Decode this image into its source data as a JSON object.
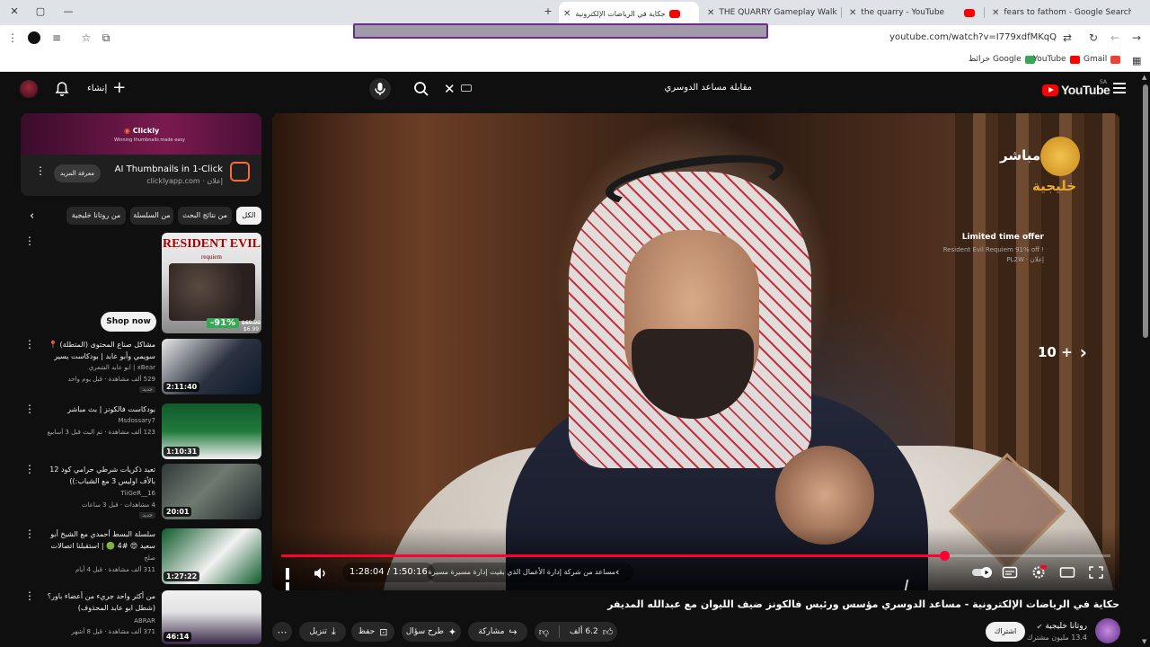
{
  "browser": {
    "tabs": [
      {
        "label": "fears to fathom - Google Search",
        "icon": "google-icon"
      },
      {
        "label": "the quarry - YouTube",
        "icon": "youtube-icon"
      },
      {
        "label": "THE QUARRY Gameplay Walkth",
        "icon": "youtube-icon"
      },
      {
        "label": "حكاية في الرياضات الإلكترونية",
        "icon": "youtube-icon",
        "active": true
      }
    ],
    "url": "youtube.com/watch?v=I779xdfMKqQ",
    "bookmarks": [
      {
        "label": "Gmail",
        "color": "#ea4335"
      },
      {
        "label": "YouTube",
        "color": "#ff0000"
      },
      {
        "label": "خرائط Google",
        "color": "#34a853"
      }
    ]
  },
  "header": {
    "logo": "YouTube",
    "country": "SA",
    "search_value": "مقابلة مساعد الدوسري",
    "create_label": "إنشاء"
  },
  "player": {
    "channel_overlay": "مباشر",
    "channel_overlay_brand": "خليجية",
    "skip_label": "10 +",
    "time_current": "1:28:04",
    "time_total": "1:50:16",
    "time_display": "1:28:04 / 1:50:16",
    "chapter": "مساعد من شركة إدارة الأعمال الذي بقيت إدارة مسيرة مسيرة عن الجهد ...",
    "progress": 0.8,
    "accent_color": "#ff0033"
  },
  "video": {
    "title": "حكاية في الرياضات الإلكترونية - مساعد الدوسري مؤسس ورئيس فالكونز ضيف الليوان مع عبدالله المديفر",
    "channel": "روتانا خليجية",
    "subscribers": "13.4 مليون مشترك",
    "subscribe": "اشتراك",
    "likes": "6.2 ألف",
    "share": "مشاركة",
    "ask": "طرح سؤال",
    "save": "حفظ",
    "download": "تنزيل"
  },
  "ad": {
    "brand": "Clickly",
    "tagline": "Winning thumbnails made easy",
    "title": "AI Thumbnails in 1-Click",
    "meta": "إعلان · clicklyapp.com",
    "cta": "معرفة المزيد"
  },
  "chips": [
    "الكل",
    "من نتائج البحث",
    "من السلسلة",
    "من روتانا خليجية"
  ],
  "promo": {
    "title": "Limited time offer",
    "desc": "Resident Evil Requiem 91% off !",
    "meta": "إعلان · PL2W",
    "shop": "Shop now",
    "game_title": "RESIDENT EVIL",
    "game_subtitle": "requiem",
    "discount": "-91%",
    "price_old": "$69.99",
    "price_new": "$6.99"
  },
  "recommendations": [
    {
      "title": "مشاكل صناع المحتوى (المتطلة) 📍 سويمي وأبو عابد | بودكاست يسير خير",
      "channel": "xBear | ابو عابد الشعري",
      "meta": "529 ألف مشاهدة · قبل يوم واحد",
      "duration": "2:11:40",
      "new": "جديد"
    },
    {
      "title": "بودكاست فالكونز | بث مباشر",
      "channel": "Msdossary7",
      "meta": "123 ألف مشاهدة · تم البث قبل 3 أسابيع",
      "duration": "1:10:31",
      "new": ""
    },
    {
      "title": "تعيد ذكريات شرطي حرامي كود 12 بالأف اوليس 3 مع الشباب:))",
      "channel": "TiiGeR__16",
      "meta": "4 مشاهدات · قبل 3 ساعات",
      "duration": "20:01",
      "new": "جديد"
    },
    {
      "title": "سلسلة البسط أحمدي مع الشيخ أبو سعيد 😍 #4 🟢 | استقبلنا اتصالات العظيم...",
      "channel": "صلح",
      "meta": "311 ألف مشاهدة · قبل 4 أيام",
      "duration": "1:27:22",
      "new": ""
    },
    {
      "title": "من أكثر واحد جريء من أعضاء باور؟ (شطل ابو عابد المحذوف)",
      "channel": "ABRAR",
      "meta": "371 ألف مشاهدة · قبل 8 أشهر",
      "duration": "46:14",
      "new": ""
    }
  ]
}
